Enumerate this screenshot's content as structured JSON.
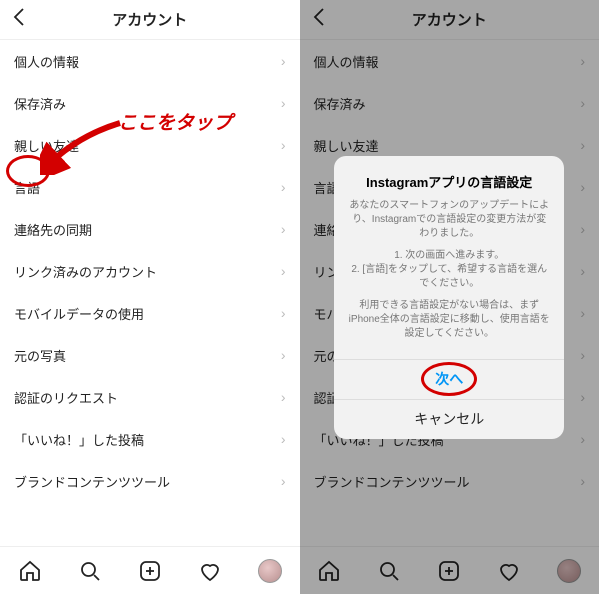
{
  "annotation": {
    "tap_here": "ここをタップ"
  },
  "left": {
    "header_title": "アカウント",
    "rows": [
      "個人の情報",
      "保存済み",
      "親しい友達",
      "言語",
      "連絡先の同期",
      "リンク済みのアカウント",
      "モバイルデータの使用",
      "元の写真",
      "認証のリクエスト",
      "「いいね！」した投稿",
      "ブランドコンテンツツール"
    ]
  },
  "right": {
    "header_title": "アカウント",
    "rows": [
      "個人の情報",
      "保存済み",
      "親しい友達",
      "言語",
      "連絡先の同期",
      "リンク済みのアカウント",
      "モバイルデータの使用",
      "元の写真",
      "認証のリクエスト",
      "「いいね！」した投稿",
      "ブランドコンテンツツール"
    ],
    "dialog": {
      "title": "Instagramアプリの言語設定",
      "p1": "あなたのスマートフォンのアップデートにより、Instagramでの言語設定の変更方法が変わりました。",
      "p2": "1. 次の画面へ進みます。\n2. [言語]をタップして、希望する言語を選んでください。",
      "p3": "利用できる言語設定がない場合は、まずiPhone全体の言語設定に移動し、使用言語を設定してください。",
      "next": "次へ",
      "cancel": "キャンセル"
    }
  }
}
